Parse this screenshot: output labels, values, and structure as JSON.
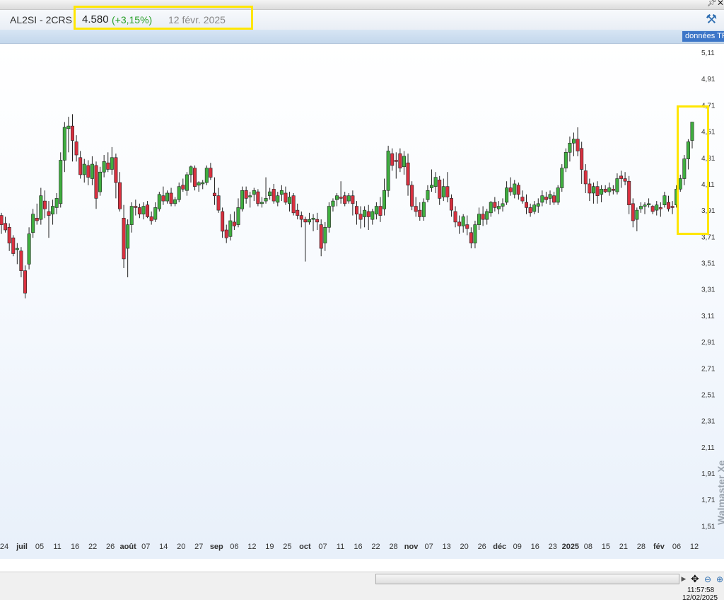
{
  "window": {
    "pin_icon": "pin-icon",
    "close_icon": "close-icon"
  },
  "header": {
    "symbol": "AL2SI - 2CRS",
    "price": "4.580",
    "change": "(+3,15%)",
    "date": "12 févr. 2025",
    "tools_icon": "tools-icon"
  },
  "subbar": {
    "data_button": "données TR"
  },
  "watermark": "Walmaster Xe",
  "status": {
    "time": "11:57:58",
    "date": "12/02/2025"
  },
  "colors": {
    "up": "#3fae3f",
    "down": "#d9303f",
    "highlight": "#ffe600",
    "accent": "#2b6cb0"
  },
  "chart_data": {
    "type": "candlestick",
    "ylim": [
      1.41,
      5.11
    ],
    "yticks": [
      5.11,
      4.91,
      4.71,
      4.51,
      4.31,
      4.11,
      3.91,
      3.71,
      3.51,
      3.31,
      3.11,
      2.91,
      2.71,
      2.51,
      2.31,
      2.11,
      1.91,
      1.71,
      1.51
    ],
    "ytick_labels": [
      "5,11",
      "4,91",
      "4,71",
      "4,51",
      "4,31",
      "4,11",
      "3,91",
      "3,71",
      "3,51",
      "3,31",
      "3,11",
      "2,91",
      "2,71",
      "2,51",
      "2,31",
      "2,11",
      "1,91",
      "1,71",
      "1,51"
    ],
    "xticks": [
      {
        "label": "24",
        "bold": false
      },
      {
        "label": "juil",
        "bold": true
      },
      {
        "label": "05",
        "bold": false
      },
      {
        "label": "11",
        "bold": false
      },
      {
        "label": "16",
        "bold": false
      },
      {
        "label": "22",
        "bold": false
      },
      {
        "label": "26",
        "bold": false
      },
      {
        "label": "août",
        "bold": true
      },
      {
        "label": "07",
        "bold": false
      },
      {
        "label": "14",
        "bold": false
      },
      {
        "label": "20",
        "bold": false
      },
      {
        "label": "27",
        "bold": false
      },
      {
        "label": "sep",
        "bold": true
      },
      {
        "label": "06",
        "bold": false
      },
      {
        "label": "12",
        "bold": false
      },
      {
        "label": "19",
        "bold": false
      },
      {
        "label": "25",
        "bold": false
      },
      {
        "label": "oct",
        "bold": true
      },
      {
        "label": "07",
        "bold": false
      },
      {
        "label": "11",
        "bold": false
      },
      {
        "label": "16",
        "bold": false
      },
      {
        "label": "22",
        "bold": false
      },
      {
        "label": "28",
        "bold": false
      },
      {
        "label": "nov",
        "bold": true
      },
      {
        "label": "07",
        "bold": false
      },
      {
        "label": "13",
        "bold": false
      },
      {
        "label": "20",
        "bold": false
      },
      {
        "label": "26",
        "bold": false
      },
      {
        "label": "déc",
        "bold": true
      },
      {
        "label": "09",
        "bold": false
      },
      {
        "label": "16",
        "bold": false
      },
      {
        "label": "23",
        "bold": false
      },
      {
        "label": "2025",
        "bold": true
      },
      {
        "label": "08",
        "bold": false
      },
      {
        "label": "15",
        "bold": false
      },
      {
        "label": "21",
        "bold": false
      },
      {
        "label": "28",
        "bold": false
      },
      {
        "label": "fév",
        "bold": true
      },
      {
        "label": "06",
        "bold": false
      },
      {
        "label": "12",
        "bold": false
      }
    ],
    "candles_ohlc": [
      [
        3.87,
        3.89,
        3.73,
        3.8
      ],
      [
        3.81,
        3.86,
        3.74,
        3.76
      ],
      [
        3.78,
        3.81,
        3.6,
        3.66
      ],
      [
        3.7,
        3.72,
        3.56,
        3.58
      ],
      [
        3.61,
        3.66,
        3.5,
        3.62
      ],
      [
        3.6,
        3.63,
        3.4,
        3.45
      ],
      [
        3.45,
        3.49,
        3.24,
        3.28
      ],
      [
        3.5,
        3.78,
        3.46,
        3.73
      ],
      [
        3.74,
        3.92,
        3.7,
        3.88
      ],
      [
        3.85,
        3.96,
        3.8,
        3.83
      ],
      [
        3.84,
        4.08,
        3.8,
        4.02
      ],
      [
        3.98,
        4.06,
        3.85,
        3.92
      ],
      [
        3.9,
        3.98,
        3.7,
        3.87
      ],
      [
        3.88,
        3.99,
        3.8,
        3.94
      ],
      [
        3.93,
        4.04,
        3.88,
        4.0
      ],
      [
        3.96,
        4.35,
        3.93,
        4.29
      ],
      [
        4.29,
        4.58,
        4.2,
        4.54
      ],
      [
        4.53,
        4.62,
        4.35,
        4.55
      ],
      [
        4.55,
        4.64,
        4.28,
        4.44
      ],
      [
        4.43,
        4.48,
        4.28,
        4.33
      ],
      [
        4.31,
        4.36,
        4.15,
        4.18
      ],
      [
        4.18,
        4.3,
        4.12,
        4.26
      ],
      [
        4.25,
        4.29,
        4.1,
        4.16
      ],
      [
        4.15,
        4.32,
        4.1,
        4.26
      ],
      [
        4.25,
        4.28,
        3.92,
        4.0
      ],
      [
        4.05,
        4.24,
        4.02,
        4.2
      ],
      [
        4.2,
        4.33,
        4.16,
        4.28
      ],
      [
        4.27,
        4.35,
        4.2,
        4.22
      ],
      [
        4.22,
        4.39,
        4.18,
        4.31
      ],
      [
        4.31,
        4.34,
        4.0,
        4.12
      ],
      [
        4.12,
        4.2,
        3.9,
        3.92
      ],
      [
        3.85,
        3.95,
        3.47,
        3.54
      ],
      [
        3.62,
        3.84,
        3.4,
        3.8
      ],
      [
        3.8,
        3.97,
        3.74,
        3.94
      ],
      [
        3.94,
        3.99,
        3.87,
        3.93
      ],
      [
        3.93,
        3.96,
        3.85,
        3.88
      ],
      [
        3.88,
        3.97,
        3.84,
        3.94
      ],
      [
        3.95,
        3.98,
        3.85,
        3.86
      ],
      [
        3.86,
        3.9,
        3.8,
        3.83
      ],
      [
        3.84,
        3.97,
        3.82,
        3.93
      ],
      [
        3.92,
        4.05,
        3.9,
        4.03
      ],
      [
        4.02,
        4.09,
        3.95,
        3.98
      ],
      [
        3.98,
        4.06,
        3.96,
        4.04
      ],
      [
        4.04,
        4.08,
        3.94,
        3.96
      ],
      [
        3.96,
        4.01,
        3.94,
        3.99
      ],
      [
        3.99,
        4.12,
        3.97,
        4.09
      ],
      [
        4.1,
        4.15,
        4.05,
        4.07
      ],
      [
        4.06,
        4.2,
        4.02,
        4.18
      ],
      [
        4.18,
        4.25,
        4.12,
        4.24
      ],
      [
        4.23,
        4.25,
        4.06,
        4.09
      ],
      [
        4.1,
        4.13,
        4.05,
        4.12
      ],
      [
        4.11,
        4.14,
        4.07,
        4.12
      ],
      [
        4.12,
        4.25,
        4.1,
        4.23
      ],
      [
        4.23,
        4.27,
        4.14,
        4.16
      ],
      [
        4.04,
        4.16,
        3.95,
        4.02
      ],
      [
        4.02,
        4.08,
        3.89,
        3.91
      ],
      [
        3.9,
        3.93,
        3.7,
        3.75
      ],
      [
        3.76,
        3.8,
        3.66,
        3.7
      ],
      [
        3.71,
        3.88,
        3.68,
        3.83
      ],
      [
        3.82,
        3.9,
        3.76,
        3.79
      ],
      [
        3.8,
        4.0,
        3.78,
        3.93
      ],
      [
        3.92,
        4.09,
        3.9,
        4.06
      ],
      [
        4.06,
        4.09,
        3.96,
        4.0
      ],
      [
        4.01,
        4.05,
        3.93,
        4.02
      ],
      [
        4.03,
        4.08,
        3.98,
        4.06
      ],
      [
        4.05,
        4.07,
        3.94,
        3.96
      ],
      [
        3.96,
        4.01,
        3.93,
        3.97
      ],
      [
        3.98,
        4.16,
        3.96,
        4.0
      ],
      [
        4.02,
        4.08,
        3.99,
        4.05
      ],
      [
        4.07,
        4.11,
        3.96,
        3.98
      ],
      [
        3.97,
        4.05,
        3.94,
        4.02
      ],
      [
        4.03,
        4.1,
        3.98,
        4.06
      ],
      [
        4.04,
        4.09,
        3.95,
        3.97
      ],
      [
        3.96,
        4.05,
        3.9,
        4.01
      ],
      [
        4.02,
        4.04,
        3.87,
        3.89
      ],
      [
        3.91,
        3.96,
        3.84,
        3.87
      ],
      [
        3.87,
        3.9,
        3.78,
        3.84
      ],
      [
        3.84,
        3.86,
        3.52,
        3.82
      ],
      [
        3.82,
        3.89,
        3.8,
        3.84
      ],
      [
        3.84,
        3.88,
        3.75,
        3.85
      ],
      [
        3.84,
        3.89,
        3.76,
        3.82
      ],
      [
        3.8,
        3.84,
        3.56,
        3.62
      ],
      [
        3.66,
        3.82,
        3.6,
        3.78
      ],
      [
        3.78,
        3.97,
        3.74,
        3.94
      ],
      [
        3.94,
        4.0,
        3.9,
        3.98
      ],
      [
        3.99,
        4.04,
        3.94,
        4.02
      ],
      [
        4.01,
        4.13,
        3.96,
        4.0
      ],
      [
        4.02,
        4.05,
        3.94,
        3.96
      ],
      [
        3.98,
        4.04,
        3.96,
        4.02
      ],
      [
        4.02,
        4.06,
        3.87,
        3.96
      ],
      [
        3.94,
        3.98,
        3.8,
        3.88
      ],
      [
        3.88,
        3.94,
        3.77,
        3.84
      ],
      [
        3.86,
        3.94,
        3.78,
        3.91
      ],
      [
        3.9,
        3.95,
        3.76,
        3.86
      ],
      [
        3.84,
        3.92,
        3.8,
        3.9
      ],
      [
        3.88,
        3.97,
        3.84,
        3.94
      ],
      [
        3.94,
        4.01,
        3.82,
        3.87
      ],
      [
        3.92,
        4.15,
        3.87,
        4.06
      ],
      [
        4.06,
        4.4,
        4.01,
        4.36
      ],
      [
        4.34,
        4.38,
        4.21,
        4.25
      ],
      [
        4.29,
        4.35,
        4.15,
        4.28
      ],
      [
        4.34,
        4.38,
        4.2,
        4.23
      ],
      [
        4.24,
        4.36,
        4.18,
        4.32
      ],
      [
        4.27,
        4.34,
        4.02,
        4.1
      ],
      [
        4.1,
        4.13,
        3.91,
        3.94
      ],
      [
        3.94,
        4.01,
        3.86,
        3.9
      ],
      [
        3.91,
        3.97,
        3.83,
        3.86
      ],
      [
        3.86,
        4.0,
        3.83,
        3.97
      ],
      [
        3.99,
        4.1,
        3.97,
        4.06
      ],
      [
        4.08,
        4.22,
        4.05,
        4.1
      ],
      [
        4.09,
        4.2,
        4.04,
        4.16
      ],
      [
        4.14,
        4.17,
        3.95,
        4.0
      ],
      [
        4.01,
        4.15,
        3.98,
        4.09
      ],
      [
        4.09,
        4.2,
        3.97,
        4.01
      ],
      [
        4.0,
        4.03,
        3.86,
        3.91
      ],
      [
        3.9,
        3.94,
        3.78,
        3.82
      ],
      [
        3.82,
        3.87,
        3.73,
        3.79
      ],
      [
        3.79,
        3.88,
        3.74,
        3.86
      ],
      [
        3.8,
        3.87,
        3.72,
        3.77
      ],
      [
        3.74,
        3.78,
        3.62,
        3.66
      ],
      [
        3.66,
        3.83,
        3.62,
        3.8
      ],
      [
        3.8,
        3.93,
        3.76,
        3.88
      ],
      [
        3.88,
        3.94,
        3.79,
        3.84
      ],
      [
        3.84,
        3.92,
        3.8,
        3.9
      ],
      [
        3.89,
        3.98,
        3.86,
        3.97
      ],
      [
        3.97,
        4.01,
        3.9,
        3.93
      ],
      [
        3.92,
        3.98,
        3.88,
        3.94
      ],
      [
        3.94,
        4.0,
        3.9,
        3.96
      ],
      [
        3.97,
        4.13,
        3.95,
        4.08
      ],
      [
        4.08,
        4.16,
        4.02,
        4.05
      ],
      [
        4.03,
        4.14,
        4.0,
        4.11
      ],
      [
        4.1,
        4.12,
        3.99,
        4.03
      ],
      [
        4.01,
        4.06,
        3.96,
        3.98
      ],
      [
        3.97,
        4.03,
        3.88,
        3.93
      ],
      [
        3.93,
        3.96,
        3.86,
        3.89
      ],
      [
        3.9,
        3.98,
        3.88,
        3.95
      ],
      [
        3.94,
        4.0,
        3.89,
        3.96
      ],
      [
        3.97,
        4.06,
        3.94,
        4.02
      ],
      [
        4.01,
        4.05,
        3.96,
        3.99
      ],
      [
        4.0,
        4.06,
        3.95,
        4.03
      ],
      [
        4.02,
        4.05,
        3.95,
        3.97
      ],
      [
        3.97,
        4.1,
        3.95,
        4.08
      ],
      [
        4.08,
        4.26,
        4.05,
        4.23
      ],
      [
        4.23,
        4.38,
        4.2,
        4.35
      ],
      [
        4.35,
        4.47,
        4.28,
        4.42
      ],
      [
        4.42,
        4.5,
        4.32,
        4.45
      ],
      [
        4.45,
        4.54,
        4.32,
        4.36
      ],
      [
        4.38,
        4.43,
        4.11,
        4.22
      ],
      [
        4.21,
        4.26,
        4.04,
        4.11
      ],
      [
        4.11,
        4.15,
        3.98,
        4.04
      ],
      [
        4.04,
        4.12,
        3.96,
        4.09
      ],
      [
        4.09,
        4.13,
        3.96,
        4.02
      ],
      [
        4.03,
        4.1,
        3.97,
        4.07
      ],
      [
        4.07,
        4.1,
        4.04,
        4.05
      ],
      [
        4.05,
        4.12,
        4.02,
        4.08
      ],
      [
        4.07,
        4.1,
        4.03,
        4.06
      ],
      [
        4.05,
        4.19,
        4.03,
        4.15
      ],
      [
        4.17,
        4.21,
        4.08,
        4.15
      ],
      [
        4.15,
        4.2,
        4.1,
        4.13
      ],
      [
        4.13,
        4.17,
        3.88,
        3.95
      ],
      [
        3.96,
        4.0,
        3.78,
        3.83
      ],
      [
        3.84,
        3.93,
        3.75,
        3.91
      ],
      [
        3.92,
        3.97,
        3.89,
        3.94
      ],
      [
        3.94,
        3.97,
        3.88,
        3.95
      ],
      [
        3.95,
        4.0,
        3.93,
        3.96
      ],
      [
        3.94,
        3.95,
        3.88,
        3.9
      ],
      [
        3.91,
        3.98,
        3.87,
        3.95
      ],
      [
        3.93,
        3.97,
        3.86,
        3.92
      ],
      [
        3.95,
        4.05,
        3.93,
        4.02
      ],
      [
        3.97,
        4.02,
        3.9,
        3.92
      ],
      [
        3.94,
        3.98,
        3.88,
        3.93
      ],
      [
        3.95,
        4.1,
        3.93,
        4.07
      ],
      [
        4.07,
        4.18,
        4.05,
        4.15
      ],
      [
        4.15,
        4.33,
        4.1,
        4.3
      ],
      [
        4.3,
        4.45,
        4.22,
        4.43
      ],
      [
        4.44,
        4.58,
        4.38,
        4.58
      ]
    ]
  }
}
